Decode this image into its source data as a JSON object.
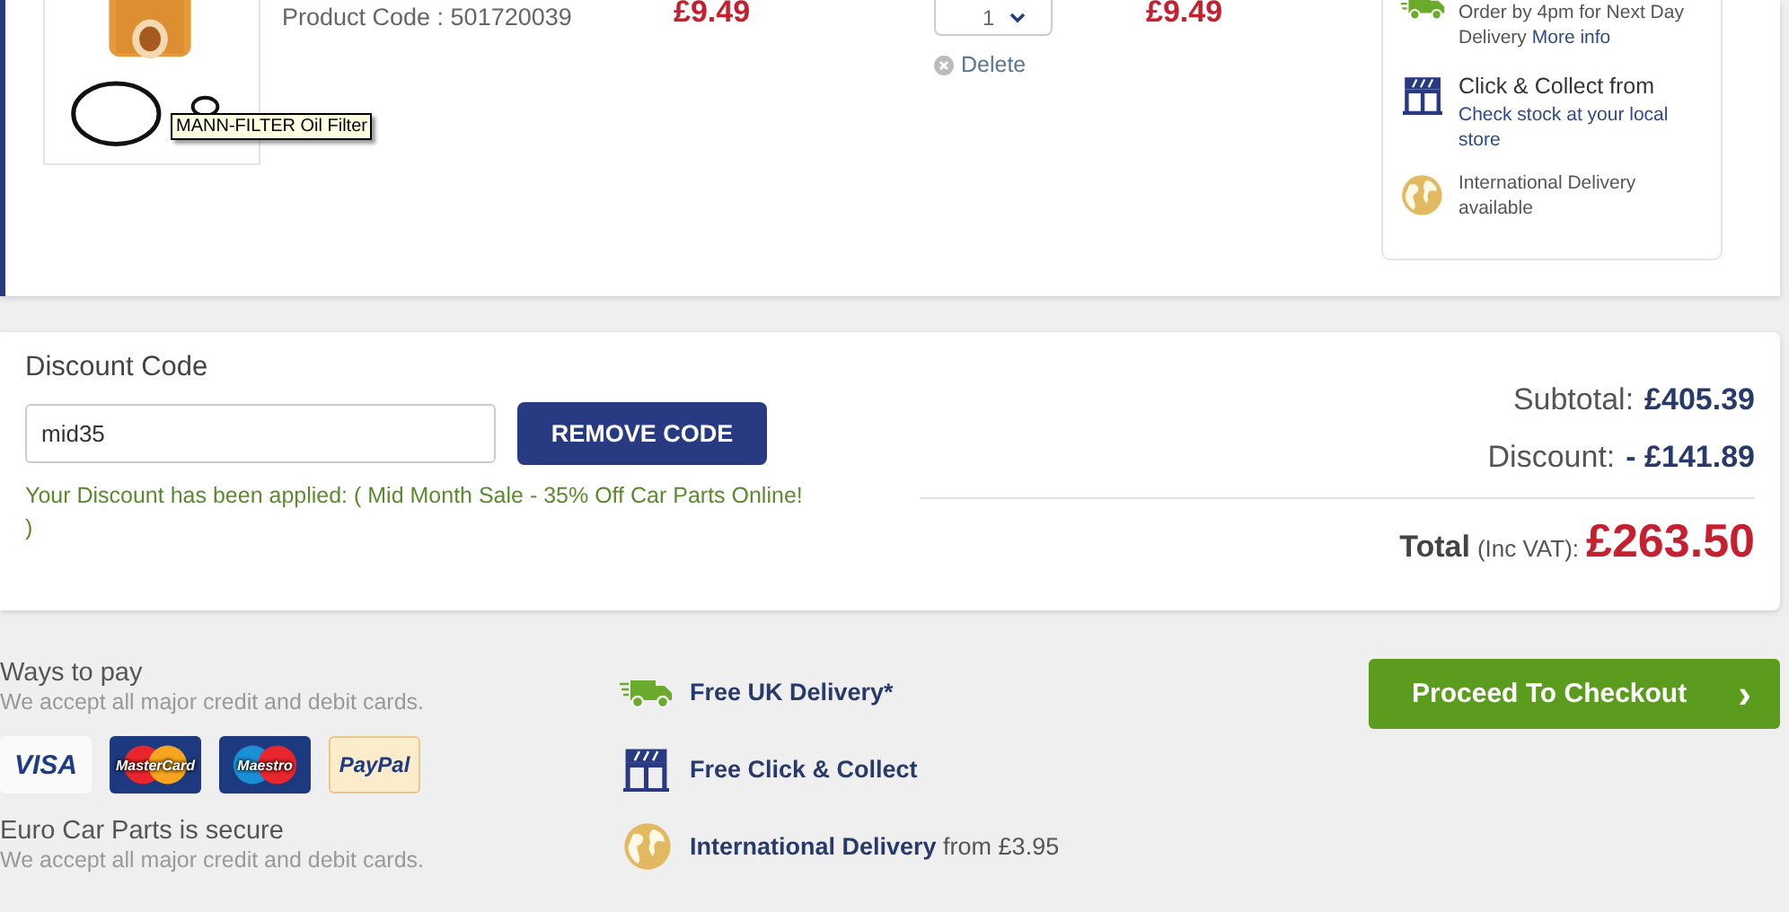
{
  "cart_item": {
    "image": {
      "kind": "picture",
      "tooltip": "MANN-FILTER Oil Filter"
    },
    "product_code": "Product Code : 501720039",
    "unit_price": "£9.49",
    "quantity": "1",
    "delete": "Delete",
    "line_total": "£9.49",
    "delivery_options": [
      {
        "kind": "truck",
        "text": "Order by 4pm for Next Day Delivery",
        "link": "More info"
      },
      {
        "kind": "store",
        "title": "Click & Collect from",
        "link": "Check stock at your local store"
      },
      {
        "kind": "globe",
        "text": "International Delivery available"
      }
    ]
  },
  "discount": {
    "heading": "Discount Code",
    "value": "mid35",
    "button": "REMOVE CODE",
    "message": "Your Discount has been applied: ( Mid Month Sale - 35% Off Car Parts Online! )"
  },
  "totals": {
    "subtotal_label": "Subtotal:",
    "subtotal": "£405.39",
    "discount_label": "Discount:",
    "discount": "- £141.89",
    "total_label": "Total",
    "total_note": "(Inc VAT):",
    "total": "£263.50"
  },
  "payment": {
    "heading": "Ways to pay",
    "subtext": "We accept all major credit and debit cards.",
    "cards": [
      {
        "kind": "visa",
        "label": "VISA"
      },
      {
        "kind": "mastercard",
        "label": "MasterCard"
      },
      {
        "kind": "maestro",
        "label": "Maestro"
      },
      {
        "kind": "paypal",
        "label": "PayPal"
      }
    ]
  },
  "security": {
    "heading": "Euro Car Parts is secure",
    "subtext": "We accept all major credit and debit cards."
  },
  "benefits": [
    {
      "kind": "truck",
      "title": "Free UK Delivery*"
    },
    {
      "kind": "store",
      "title": "Free Click & Collect"
    },
    {
      "kind": "globe",
      "title": "International Delivery",
      "extra": "from £3.95"
    }
  ],
  "checkout_button": {
    "label": "Proceed To Checkout",
    "chevron": "›"
  }
}
